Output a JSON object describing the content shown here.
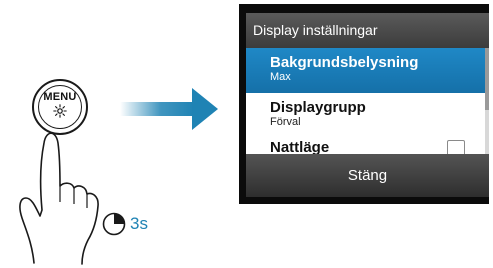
{
  "menu_key": {
    "label": "MENU",
    "icon": "sun-icon"
  },
  "hold_duration": "3s",
  "accent_color": "#1f83b4",
  "dialog": {
    "title": "Display inställningar",
    "items": [
      {
        "label": "Bakgrundsbelysning",
        "value": "Max"
      },
      {
        "label": "Displaygrupp",
        "value": "Förval"
      },
      {
        "label": "Nattläge"
      }
    ],
    "close_label": "Stäng"
  }
}
